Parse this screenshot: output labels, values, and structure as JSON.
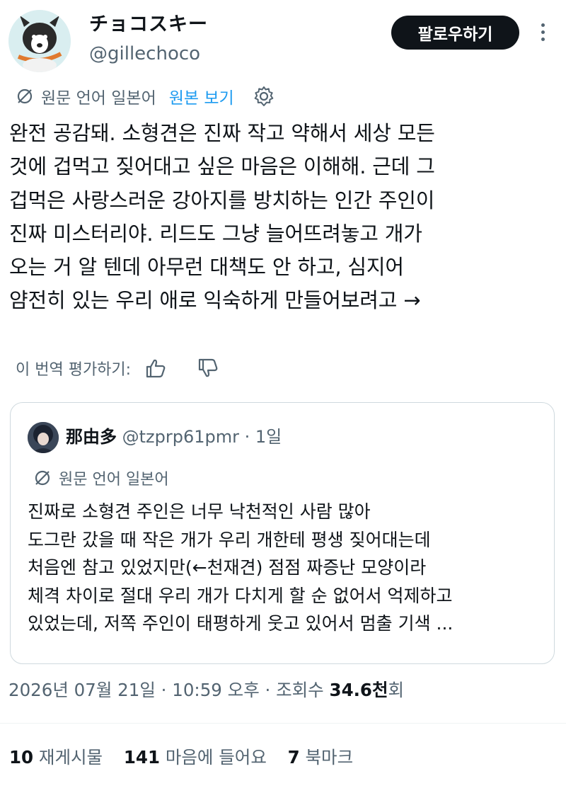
{
  "author": {
    "display_name": "チョコスキー",
    "handle": "@gillechoco",
    "follow_label": "팔로우하기"
  },
  "translation": {
    "source_lang": "원문 언어 일본어",
    "show_original": "원본 보기"
  },
  "tweet": {
    "text": "완전 공감돼. 소형견은 진짜 작고 약해서 세상 모든\n것에 겁먹고 짖어대고 싶은 마음은 이해해. 근데 그\n겁먹은 사랑스러운 강아지를 방치하는 인간 주인이\n진짜 미스터리야. 리드도 그냥 늘어뜨려놓고 개가\n오는 거 알 텐데 아무런 대책도 안 하고, 심지어\n얌전히 있는 우리 애로 익숙하게 만들어보려고 →"
  },
  "rating": {
    "label": "이 번역 평가하기:"
  },
  "quoted": {
    "name": "那由多",
    "handle": "@tzprp61pmr",
    "separator": " · ",
    "time": "1일",
    "source_lang": "원문 언어 일본어",
    "text": "진짜로 소형견 주인은 너무 낙천적인 사람 많아\n도그란 갔을 때 작은 개가 우리 개한테 평생 짖어대는데\n처음엔 참고 있었지만(←천재견) 점점 짜증난 모양이라\n체격 차이로 절대 우리 개가 다치게 할 순 없어서 억제하고\n있었는데, 저쪽 주인이 태평하게 웃고 있어서 멈출 기색 ..."
  },
  "meta": {
    "datetime": "2026년 07월 21일 · 10:59 오후 · 조회수 ",
    "views_count": "34.6천",
    "views_suffix": "회"
  },
  "stats": {
    "reposts_count": "10",
    "reposts_label": "재게시물",
    "likes_count": "141",
    "likes_label": "마음에 들어요",
    "bookmarks_count": "7",
    "bookmarks_label": "북마크"
  },
  "colors": {
    "text": "#0f1419",
    "muted": "#536471",
    "link": "#1d9bf0",
    "border": "#cfd9de"
  },
  "icons": [
    "globe-off-icon",
    "gear-icon",
    "thumbs-up-icon",
    "thumbs-down-icon",
    "more-icon"
  ]
}
